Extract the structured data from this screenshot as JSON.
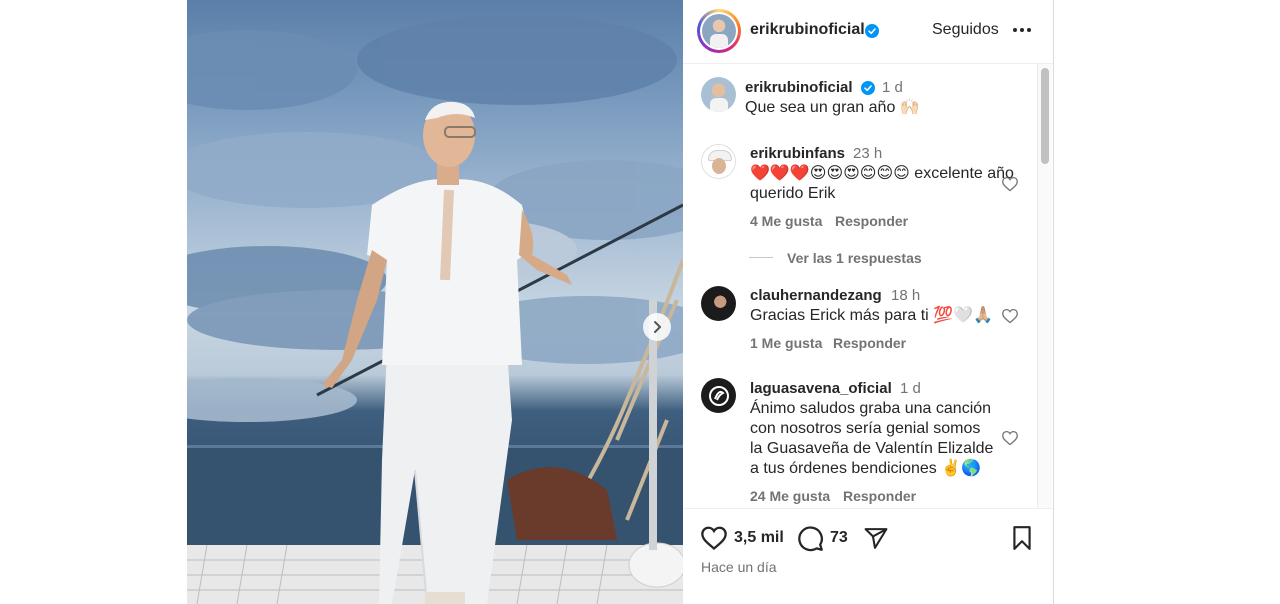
{
  "post": {
    "author": "erikrubinoficial",
    "follow_status": "Seguidos",
    "more_label": "•••"
  },
  "caption": {
    "username": "erikrubinoficial",
    "time": "1 d",
    "text": "Que sea un gran año 🙌🏻"
  },
  "comments": [
    {
      "username": "erikrubinfans",
      "time": "23 h",
      "text_line1": "❤️❤️❤️😍😍😍😊😊😊 excelente año",
      "text_line2": "querido Erik",
      "likes": "4 Me gusta",
      "reply": "Responder",
      "view_replies": "Ver las 1 respuestas"
    },
    {
      "username": "clauhernandezang",
      "time": "18 h",
      "text_line1": "Gracias Erick más para ti 💯🤍🙏🏼",
      "likes": "1 Me gusta",
      "reply": "Responder"
    },
    {
      "username": "laguasavena_oficial",
      "time": "1 d",
      "text_line1": "Ánimo saludos graba una canción",
      "text_line2": "con nosotros sería genial somos",
      "text_line3": "la Guasaveña de Valentín Elizalde",
      "text_line4": "a tus órdenes bendiciones ✌️🌎",
      "likes": "24 Me gusta",
      "reply": "Responder"
    }
  ],
  "actions": {
    "likes_count": "3,5 mil",
    "comments_count": "73",
    "posted_ago": "Hace un día"
  },
  "icons": {
    "verified": "verified-badge-icon",
    "more": "more-options-icon",
    "heart": "heart-icon",
    "comment": "comment-icon",
    "share": "share-icon",
    "save": "bookmark-icon",
    "next": "chevron-right-icon"
  },
  "colors": {
    "verified_blue": "#0095f6",
    "text": "#262626",
    "muted": "#737373"
  }
}
